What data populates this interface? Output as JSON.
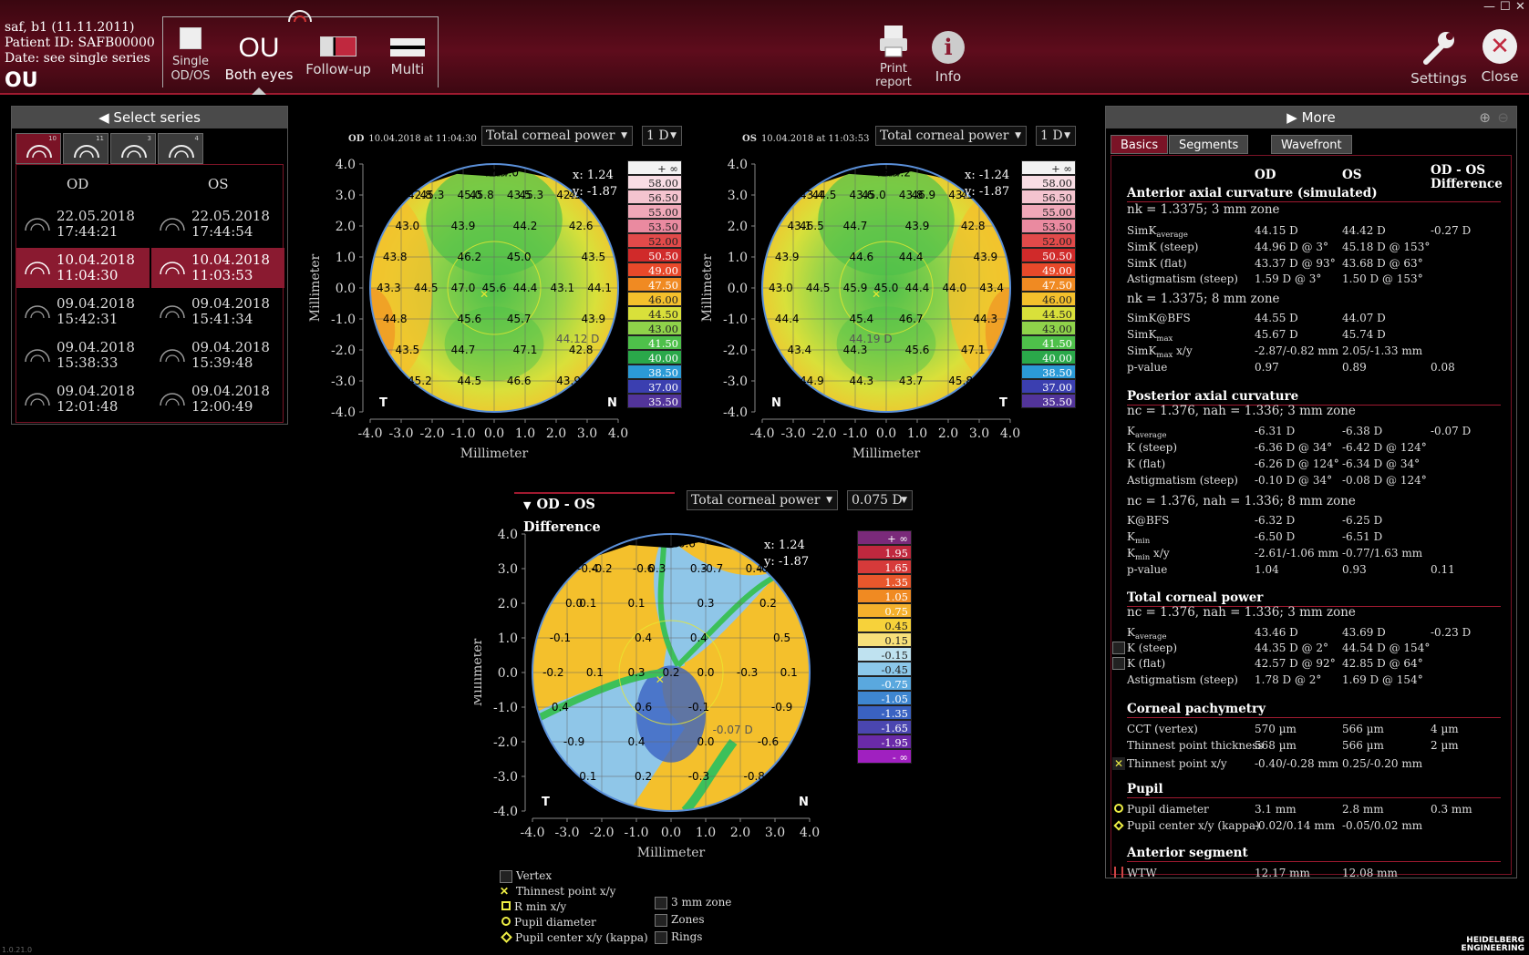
{
  "header": {
    "patient_line1": "saf, b1 (11.11.2011)",
    "patient_line2": "Patient ID: SAFB00000",
    "patient_line3": "Date: see single series",
    "eye_mode": "OU",
    "view_buttons": [
      {
        "label1": "Single",
        "label2": "OD/OS"
      },
      {
        "label1": "Both eyes",
        "label2": ""
      },
      {
        "label1": "Follow-up",
        "label2": ""
      },
      {
        "label1": "Multi",
        "label2": ""
      }
    ],
    "ou_glyph": "OU",
    "print_label1": "Print",
    "print_label2": "report",
    "info_label": "Info",
    "settings_label": "Settings",
    "close_label": "Close",
    "version": "1.0.21.0"
  },
  "series_panel": {
    "title": "Select series",
    "tab_counts": [
      "10",
      "11",
      "3",
      "4"
    ],
    "col_od": "OD",
    "col_os": "OS",
    "rows": [
      {
        "od_date": "22.05.2018",
        "od_time": "17:44:21",
        "os_date": "22.05.2018",
        "os_time": "17:44:54"
      },
      {
        "od_date": "10.04.2018",
        "od_time": "11:04:30",
        "os_date": "10.04.2018",
        "os_time": "11:03:53"
      },
      {
        "od_date": "09.04.2018",
        "od_time": "15:42:31",
        "os_date": "09.04.2018",
        "os_time": "15:41:34"
      },
      {
        "od_date": "09.04.2018",
        "od_time": "15:38:33",
        "os_date": "09.04.2018",
        "os_time": "15:39:48"
      },
      {
        "od_date": "09.04.2018",
        "od_time": "12:01:48",
        "os_date": "09.04.2018",
        "os_time": "12:00:49"
      }
    ]
  },
  "map_od": {
    "eye": "OD",
    "date": "10.04.2018 at 11:04:30",
    "type": "Total corneal power",
    "step": "1 D",
    "cursor_x": "x: 1.24",
    "cursor_y": "y: -1.87",
    "cursor_value": "44.12 D",
    "left_dir": "T",
    "right_dir": "N",
    "values": [
      "42.9",
      "42.8",
      "45.0",
      "43.5",
      "42.9",
      "43.0",
      "43.9",
      "44.2",
      "42.6",
      "43.8",
      "46.2",
      "45.0",
      "43.5",
      "43.3",
      "44.5",
      "47.0",
      "45.6",
      "44.4",
      "43.1",
      "44.1",
      "44.8",
      "45.6",
      "45.7",
      "43.9",
      "43.5",
      "44.7",
      "47.1",
      "42.8",
      "45.2",
      "44.5",
      "46.6",
      "43.9",
      "44.0",
      "45.3",
      "45.8",
      "45.3",
      "45.1"
    ]
  },
  "map_os": {
    "eye": "OS",
    "date": "10.04.2018 at 11:03:53",
    "type": "Total corneal power",
    "step": "1 D",
    "cursor_x": "x: -1.24",
    "cursor_y": "y: -1.87",
    "cursor_value": "44.19 D",
    "left_dir": "N",
    "right_dir": "T",
    "values": [
      "43.3",
      "43.4",
      "43.6",
      "43.8",
      "43.3",
      "43.1",
      "44.7",
      "43.9",
      "42.8",
      "43.9",
      "44.6",
      "44.4",
      "43.9",
      "43.0",
      "44.5",
      "45.9",
      "45.0",
      "44.4",
      "44.0",
      "43.4",
      "44.4",
      "45.4",
      "46.7",
      "44.3",
      "43.4",
      "44.3",
      "45.6",
      "47.1",
      "44.9",
      "44.3",
      "43.7",
      "45.8",
      "44.2",
      "44.5",
      "45.0",
      "46.9",
      "45.6",
      "46.5"
    ]
  },
  "map_diff": {
    "title": "OD - OS Difference",
    "type": "Total corneal power",
    "step": "0.075 D",
    "cursor_x": "x: 1.24",
    "cursor_y": "y: -1.87",
    "cursor_value": "-0.07 D",
    "left_dir": "T",
    "right_dir": "N",
    "values": [
      "0.3",
      "-0.4",
      "-0.6",
      "0.3",
      "0.4",
      "0.0",
      "0.1",
      "0.3",
      "0.2",
      "-0.1",
      "0.4",
      "0.4",
      "0.5",
      "-0.2",
      "0.1",
      "0.3",
      "0.2",
      "0.0",
      "-0.3",
      "0.1",
      "0.4",
      "0.6",
      "-0.1",
      "-0.9",
      "-0.9",
      "0.4",
      "0.0",
      "-0.6",
      "0.1",
      "0.2",
      "-0.3",
      "-0.8",
      "-0.6",
      "-0.2",
      "0.3",
      "-0.7",
      "-0.3",
      "0.1"
    ]
  },
  "scale_abs": [
    "+ ∞",
    "58.00",
    "56.50",
    "55.00",
    "53.50",
    "52.00",
    "50.50",
    "49.00",
    "47.50",
    "46.00",
    "44.50",
    "43.00",
    "41.50",
    "40.00",
    "38.50",
    "37.00",
    "35.50"
  ],
  "scale_diff": [
    "+ ∞",
    "1.95",
    "1.65",
    "1.35",
    "1.05",
    "0.75",
    "0.45",
    "0.15",
    "-0.15",
    "-0.45",
    "-0.75",
    "-1.05",
    "-1.35",
    "-1.65",
    "-1.95",
    "- ∞"
  ],
  "axes": {
    "ticks": [
      "4.0",
      "3.0",
      "2.0",
      "1.0",
      "0.0",
      "-1.0",
      "-2.0",
      "-3.0",
      "-4.0"
    ],
    "xticks": [
      "-4.0",
      "-3.0",
      "-2.0",
      "-1.0",
      "0.0",
      "1.0",
      "2.0",
      "3.0",
      "4.0"
    ],
    "label": "Millimeter"
  },
  "legend": {
    "vertex": "Vertex",
    "thinnest": "Thinnest point x/y",
    "rmin": "R min x/y",
    "pupil_d": "Pupil diameter",
    "pupil_c": "Pupil center x/y (kappa)",
    "zone3": "3 mm zone",
    "zones": "Zones",
    "rings": "Rings"
  },
  "right_panel": {
    "title": "More",
    "tabs": [
      "Basics",
      "Segments",
      "Wavefront"
    ],
    "col_od": "OD",
    "col_os": "OS",
    "col_diff1": "OD - OS",
    "col_diff2": "Difference",
    "sections": [
      {
        "title": "Anterior axial curvature (simulated)",
        "sub": "nk = 1.3375; 3 mm zone",
        "rows": [
          {
            "label": "SimK",
            "sub": "average",
            "od": "44.15 D",
            "os": "44.42 D",
            "diff": "-0.27 D"
          },
          {
            "label": "SimK (steep)",
            "sub": "",
            "od": "44.96 D @ 3°",
            "os": "45.18 D @ 153°",
            "diff": ""
          },
          {
            "label": "SimK (flat)",
            "sub": "",
            "od": "43.37 D @ 93°",
            "os": "43.68 D @ 63°",
            "diff": ""
          },
          {
            "label": "Astigmatism (steep)",
            "sub": "",
            "od": "1.59 D @ 3°",
            "os": "1.50 D @ 153°",
            "diff": ""
          }
        ]
      },
      {
        "title": "",
        "sub": "nk = 1.3375; 8 mm zone",
        "rows": [
          {
            "label": "SimK@BFS",
            "sub": "",
            "od": "44.55 D",
            "os": "44.07 D",
            "diff": ""
          },
          {
            "label": "SimK",
            "sub": "max",
            "od": "45.67 D",
            "os": "45.74 D",
            "diff": ""
          },
          {
            "label": "SimK",
            "sub": "max",
            "suffix": " x/y",
            "od": "-2.87/-0.82 mm",
            "os": "2.05/-1.33 mm",
            "diff": ""
          },
          {
            "label": "p-value",
            "sub": "",
            "od": "0.97",
            "os": "0.89",
            "diff": "0.08"
          }
        ]
      },
      {
        "title": "Posterior axial curvature",
        "sub": "nc = 1.376, nah = 1.336; 3 mm zone",
        "rows": [
          {
            "label": "K",
            "sub": "average",
            "od": "-6.31 D",
            "os": "-6.38 D",
            "diff": "-0.07 D"
          },
          {
            "label": "K (steep)",
            "sub": "",
            "od": "-6.36 D @ 34°",
            "os": "-6.42 D @ 124°",
            "diff": ""
          },
          {
            "label": "K (flat)",
            "sub": "",
            "od": "-6.26 D @ 124°",
            "os": "-6.34 D @ 34°",
            "diff": ""
          },
          {
            "label": "Astigmatism (steep)",
            "sub": "",
            "od": "-0.10 D @ 34°",
            "os": "-0.08 D @ 124°",
            "diff": ""
          }
        ]
      },
      {
        "title": "",
        "sub": "nc = 1.376, nah = 1.336; 8 mm zone",
        "rows": [
          {
            "label": "K@BFS",
            "sub": "",
            "od": "-6.32 D",
            "os": "-6.25 D",
            "diff": ""
          },
          {
            "label": "K",
            "sub": "min",
            "od": "-6.50 D",
            "os": "-6.51 D",
            "diff": ""
          },
          {
            "label": "K",
            "sub": "min",
            "suffix": " x/y",
            "od": "-2.61/-1.06 mm",
            "os": "-0.77/1.63 mm",
            "diff": ""
          },
          {
            "label": "p-value",
            "sub": "",
            "od": "1.04",
            "os": "0.93",
            "diff": "0.11"
          }
        ]
      },
      {
        "title": "Total corneal power",
        "sub": "nc = 1.376, nah = 1.336; 3 mm zone",
        "rows": [
          {
            "label": "K",
            "sub": "average",
            "od": "43.46 D",
            "os": "43.69 D",
            "diff": "-0.23 D"
          },
          {
            "label": "K (steep)",
            "sub": "",
            "od": "44.35 D @ 2°",
            "os": "44.54 D @ 154°",
            "diff": "",
            "chk": true
          },
          {
            "label": "K (flat)",
            "sub": "",
            "od": "42.57 D @ 92°",
            "os": "42.85 D @ 64°",
            "diff": "",
            "chk": true
          },
          {
            "label": "Astigmatism (steep)",
            "sub": "",
            "od": "1.78 D @ 2°",
            "os": "1.69 D @ 154°",
            "diff": ""
          }
        ]
      },
      {
        "title": "Corneal pachymetry",
        "sub": "",
        "rows": [
          {
            "label": "CCT (vertex)",
            "sub": "",
            "od": "570 µm",
            "os": "566 µm",
            "diff": "4 µm"
          },
          {
            "label": "Thinnest point thickness",
            "sub": "",
            "od": "568 µm",
            "os": "566 µm",
            "diff": "2 µm"
          },
          {
            "label": "Thinnest point x/y",
            "sub": "",
            "od": "-0.40/-0.28 mm",
            "os": "0.25/-0.20 mm",
            "diff": "",
            "mark": "x"
          }
        ]
      },
      {
        "title": "Pupil",
        "sub": "",
        "rows": [
          {
            "label": "Pupil diameter",
            "sub": "",
            "od": "3.1 mm",
            "os": "2.8 mm",
            "diff": "0.3 mm",
            "mark": "o"
          },
          {
            "label": "Pupil center x/y (kappa)",
            "sub": "",
            "od": "-0.02/0.14 mm",
            "os": "-0.05/0.02 mm",
            "diff": "",
            "mark": "d"
          }
        ]
      },
      {
        "title": "Anterior segment",
        "sub": "",
        "rows": [
          {
            "label": "WTW",
            "sub": "",
            "od": "12.17 mm",
            "os": "12.08 mm",
            "diff": "",
            "mark": "w"
          }
        ]
      }
    ]
  },
  "brand": "HEIDELBERG ENGINEERING",
  "colors": {
    "accent": "#8a1a30",
    "topbar": "#5e0c1c"
  }
}
